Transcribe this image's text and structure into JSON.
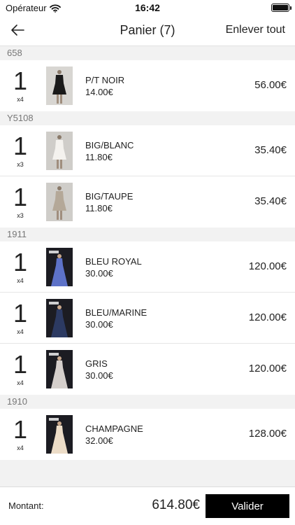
{
  "status_bar": {
    "carrier": "Opérateur",
    "time": "16:42"
  },
  "nav": {
    "title": "Panier (7)",
    "clear_all": "Enlever tout"
  },
  "sections": [
    {
      "header": "658",
      "items": [
        {
          "qty": "1",
          "pack": "x4",
          "name": "P/T NOIR",
          "unit_price": "14.00€",
          "total": "56.00€",
          "photo": "black-dress"
        }
      ]
    },
    {
      "header": "Y5108",
      "items": [
        {
          "qty": "1",
          "pack": "x3",
          "name": "BIG/BLANC",
          "unit_price": "11.80€",
          "total": "35.40€",
          "photo": "white-top"
        },
        {
          "qty": "1",
          "pack": "x3",
          "name": "BIG/TAUPE",
          "unit_price": "11.80€",
          "total": "35.40€",
          "photo": "taupe-top"
        }
      ]
    },
    {
      "header": "1911",
      "items": [
        {
          "qty": "1",
          "pack": "x4",
          "name": "BLEU ROYAL",
          "unit_price": "30.00€",
          "total": "120.00€",
          "photo": "royal-blue-gown"
        },
        {
          "qty": "1",
          "pack": "x4",
          "name": "BLEU/MARINE",
          "unit_price": "30.00€",
          "total": "120.00€",
          "photo": "navy-gown"
        },
        {
          "qty": "1",
          "pack": "x4",
          "name": "GRIS",
          "unit_price": "30.00€",
          "total": "120.00€",
          "photo": "grey-gown"
        }
      ]
    },
    {
      "header": "1910",
      "items": [
        {
          "qty": "1",
          "pack": "x4",
          "name": "CHAMPAGNE",
          "unit_price": "32.00€",
          "total": "128.00€",
          "photo": "champagne-gown"
        }
      ]
    }
  ],
  "footer": {
    "amount_label": "Montant:",
    "amount_total": "614.80€",
    "validate_label": "Valider"
  },
  "colors": {
    "black-dress": {
      "bg": "#d8d6d2",
      "dress": "#1a1a1a",
      "dark": false
    },
    "white-top": {
      "bg": "#cfcdc9",
      "dress": "#f4f2ee",
      "dark": false
    },
    "taupe-top": {
      "bg": "#cfcdc9",
      "dress": "#b4a898",
      "dark": false
    },
    "royal-blue-gown": {
      "bg": "#1c1c22",
      "dress": "#5d72c8",
      "dark": true
    },
    "navy-gown": {
      "bg": "#1c1c22",
      "dress": "#2c3a62",
      "dark": true
    },
    "grey-gown": {
      "bg": "#1c1c22",
      "dress": "#d5cfcc",
      "dark": true
    },
    "champagne-gown": {
      "bg": "#1c1c22",
      "dress": "#ecdcc7",
      "dark": true
    }
  }
}
